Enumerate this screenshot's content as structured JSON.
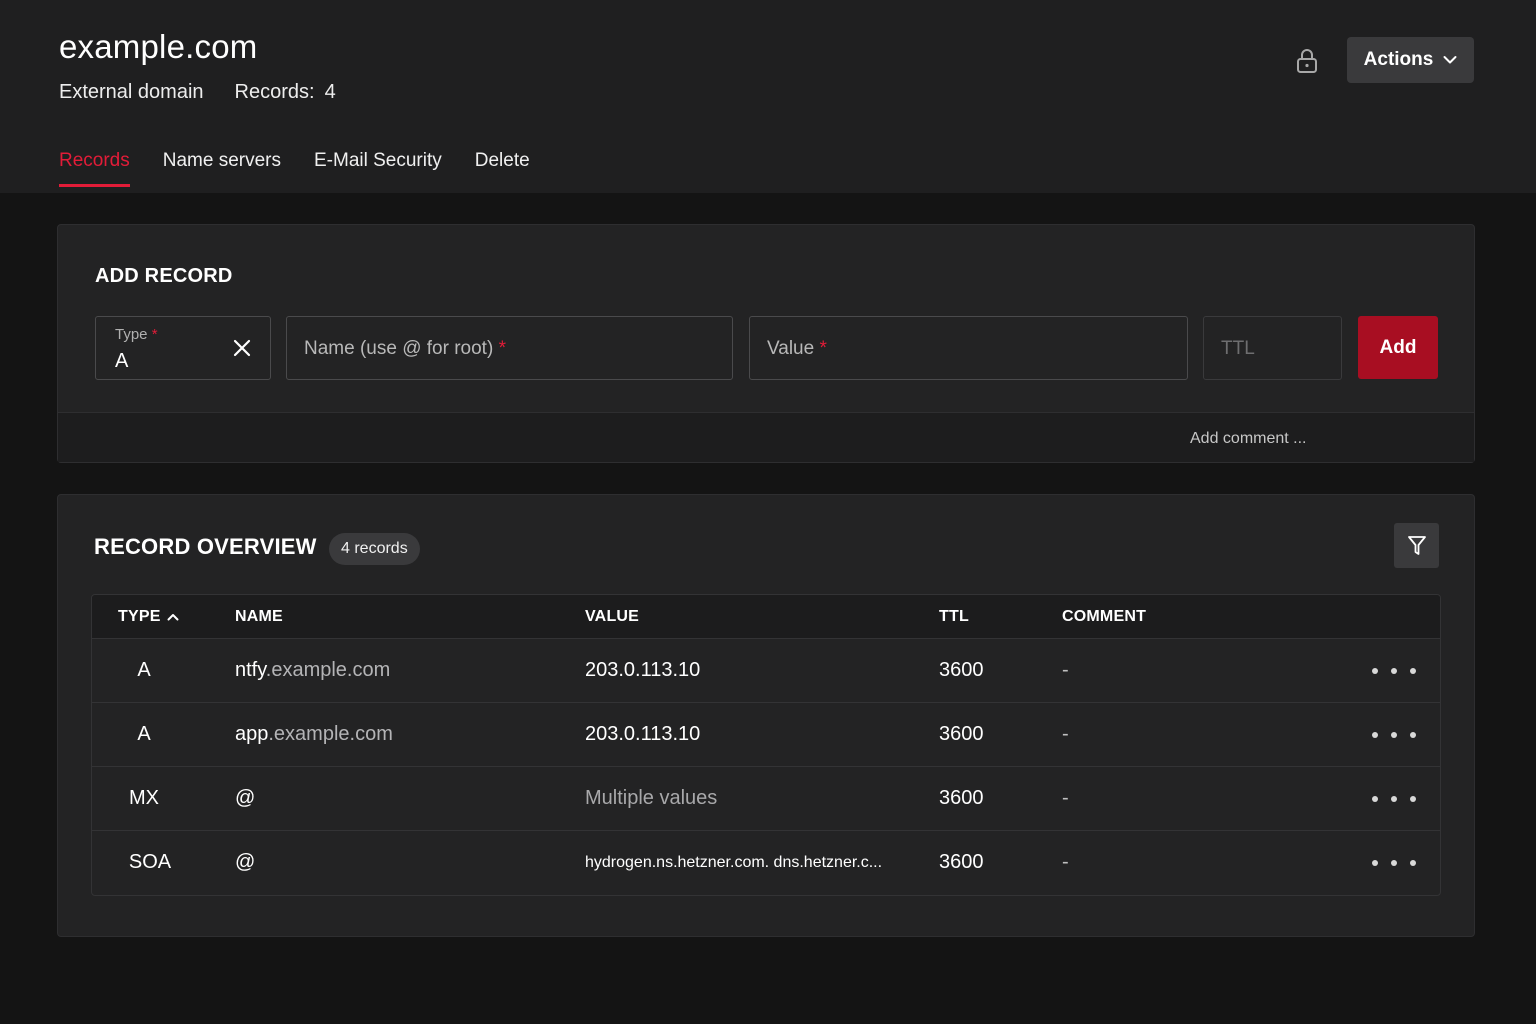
{
  "header": {
    "domain": "example.com",
    "subtitle": "External domain",
    "records_label": "Records:",
    "records_count": "4",
    "actions_label": "Actions"
  },
  "tabs": [
    {
      "label": "Records",
      "active": true
    },
    {
      "label": "Name servers",
      "active": false
    },
    {
      "label": "E-Mail Security",
      "active": false
    },
    {
      "label": "Delete",
      "active": false
    }
  ],
  "add_record": {
    "title": "ADD RECORD",
    "type_label": "Type",
    "type_value": "A",
    "name_placeholder": "Name (use @ for root)",
    "value_placeholder": "Value",
    "ttl_placeholder": "TTL",
    "required_mark": "*",
    "add_label": "Add",
    "comment_link": "Add comment ..."
  },
  "overview": {
    "title": "RECORD OVERVIEW",
    "badge": "4 records",
    "columns": {
      "type": "TYPE",
      "name": "NAME",
      "value": "VALUE",
      "ttl": "TTL",
      "comment": "COMMENT"
    },
    "rows": [
      {
        "type": "A",
        "name_host": "ntfy",
        "name_domain": ".example.com",
        "value": "203.0.113.10",
        "ttl": "3600",
        "comment": "-"
      },
      {
        "type": "A",
        "name_host": "app",
        "name_domain": ".example.com",
        "value": "203.0.113.10",
        "ttl": "3600",
        "comment": "-"
      },
      {
        "type": "MX",
        "name_host": "@",
        "name_domain": "",
        "value": "Multiple values",
        "ttl": "3600",
        "comment": "-"
      },
      {
        "type": "SOA",
        "name_host": "@",
        "name_domain": "",
        "value": "hydrogen.ns.hetzner.com. dns.hetzner.c...",
        "ttl": "3600",
        "comment": "-"
      }
    ]
  },
  "colors": {
    "accent": "#e21c38",
    "add_button": "#a80e22",
    "background": "#141414",
    "card": "#232324"
  },
  "icons": [
    "lock-icon",
    "chevron-down-icon",
    "close-icon",
    "filter-icon",
    "sort-up-icon",
    "more-dots-icon"
  ]
}
